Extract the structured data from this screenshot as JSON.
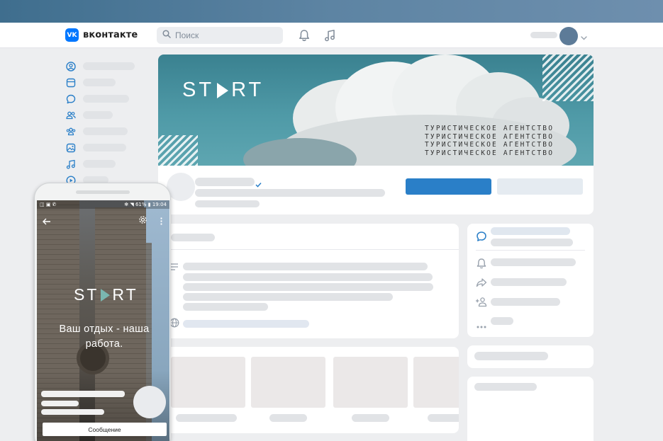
{
  "header": {
    "logo_badge": "VK",
    "logo_text": "вконтакте",
    "search_placeholder": "Поиск",
    "icons": [
      "bell-icon",
      "music-icon",
      "chevron-down-icon"
    ]
  },
  "sidebar": {
    "icons": [
      "user-circle-icon",
      "news-icon",
      "message-icon",
      "friends-icon",
      "communities-icon",
      "photo-icon",
      "music-icon",
      "video-icon"
    ]
  },
  "cover": {
    "logo_left": "ST",
    "logo_right": "RT",
    "agency_lines": [
      "ТУРИСТИЧЕСКОЕ АГЕНТСТВО",
      "ТУРИСТИЧЕСКОЕ АГЕНТСТВО",
      "ТУРИСТИЧЕСКОЕ АГЕНТСТВО",
      "ТУРИСТИЧЕСКОЕ АГЕНТСТВО"
    ]
  },
  "colors": {
    "accent": "#2a7fc8",
    "vk_blue": "#0077ff",
    "skeleton": "#e1e3e6",
    "background": "#edeef0"
  },
  "mobile": {
    "status_left": "◫ ▣ ✆",
    "status_right": "✻ ◥ 61% ▮ 19:04",
    "logo_left": "ST",
    "logo_right": "RT",
    "slogan": "Ваш отдых - наша работа.",
    "message_button": "Сообщение"
  }
}
